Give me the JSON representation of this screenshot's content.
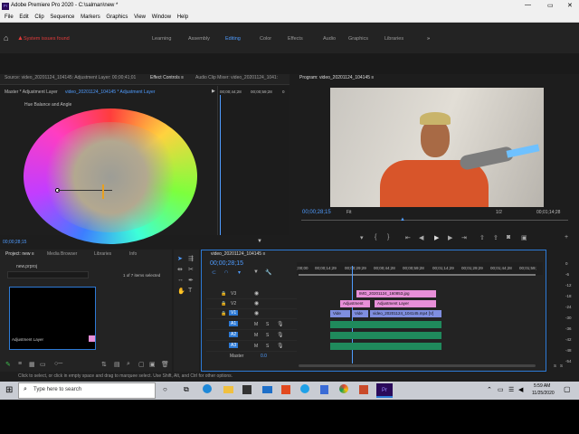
{
  "window": {
    "title": "Adobe Premiere Pro 2020 - C:\\salman\\new *",
    "min": "—",
    "max": "▭",
    "close": "✕"
  },
  "menu": [
    "File",
    "Edit",
    "Clip",
    "Sequence",
    "Markers",
    "Graphics",
    "View",
    "Window",
    "Help"
  ],
  "workspace": {
    "warning": "System issues found",
    "tabs": [
      "Learning",
      "Assembly",
      "Editing",
      "Color",
      "Effects",
      "Audio",
      "Graphics",
      "Libraries"
    ],
    "active": "Editing",
    "more": "»"
  },
  "source_tabs": {
    "source": "Source: video_20201124_104145: Adjustment Layer: 00;00;41;01",
    "effect_controls": "Effect Controls ≡",
    "audio_mixer": "Audio Clip Mixer: video_20201124_1041:"
  },
  "effect_controls": {
    "master": "Master * Adjustment Layer",
    "clip": "video_20201124_104145 * Adjustment Layer",
    "section": "Hue Balance and Angle",
    "time_start": "00;00;44;28",
    "time_end": "00;00;59;28",
    "zero": "0",
    "current": "00;00;28;15"
  },
  "program": {
    "title": "Program: video_20201124_104145 ≡",
    "timecode": "00;00;28;15",
    "fit": "Fit",
    "ratio": "1/2",
    "duration": "00;01;14;28"
  },
  "project": {
    "tabs": [
      "Project: new ≡",
      "Media Browser",
      "Libraries",
      "Info"
    ],
    "file": "new.prproj",
    "selected": "1 of 7 items selected",
    "thumb_label": "Adjustment Layer"
  },
  "timeline": {
    "tab": "video_20201124_104145 ≡",
    "timecode": "00;00;28;15",
    "ruler": [
      ";00;00",
      "00;00;14;29",
      "00;00;29;29",
      "00;00;44;28",
      "00;00;59;28",
      "00;01;14;29",
      "00;01;29;29",
      "00;01;44;28",
      "00;01;59;"
    ],
    "tracks": [
      {
        "name": "V3",
        "type": "video"
      },
      {
        "name": "V2",
        "type": "video"
      },
      {
        "name": "V1",
        "type": "video"
      },
      {
        "name": "A1",
        "type": "audio"
      },
      {
        "name": "A2",
        "type": "audio"
      },
      {
        "name": "A3",
        "type": "audio"
      }
    ],
    "clips": {
      "v3": "IMG_20201124_160853.jpg",
      "v2a": "Adjustment",
      "v2b": "Adjustment Layer",
      "v1a": "Vide",
      "v1b": "Vide",
      "v1c": "video_20201124_104145.mp4 [V]"
    },
    "master": "Master",
    "master_val": "0.0"
  },
  "meters": [
    "0",
    "-6",
    "-12",
    "-18",
    "-24",
    "-30",
    "-36",
    "-42",
    "-48",
    "-54"
  ],
  "meter_labels": [
    "S",
    "S"
  ],
  "statusbar": "Click to select, or click in empty space and drag to marquee select. Use Shift, Alt, and Ctrl for other options.",
  "taskbar": {
    "search": "Type here to search",
    "time": "5:59 AM",
    "date": "11/25/2020"
  },
  "colors": {
    "accent": "#2d7ad6",
    "timecode": "#4f9cff",
    "warning": "#e23b3b",
    "v3clip": "#e78fd8",
    "audio": "#1f8a5c"
  }
}
